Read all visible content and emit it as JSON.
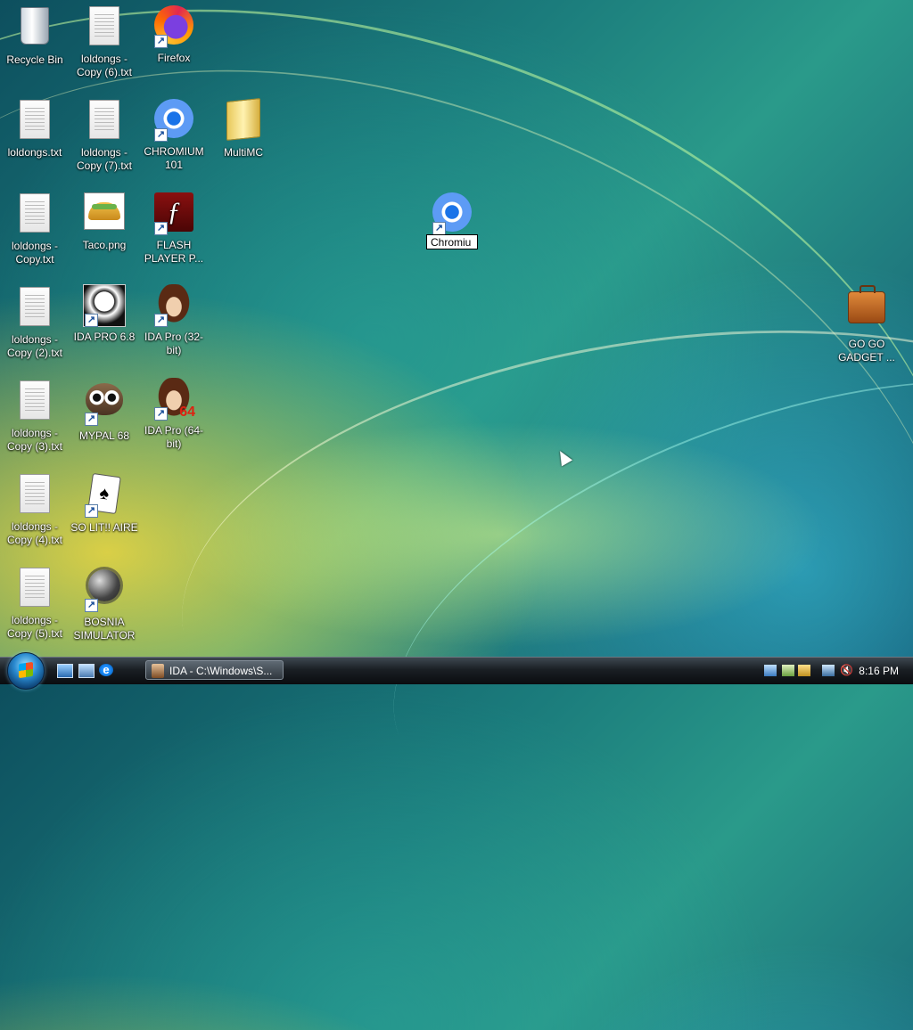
{
  "desktop_icons": [
    {
      "label": "Recycle Bin",
      "icon": "recycle-bin-icon"
    },
    {
      "label": "loldongs - Copy (6).txt",
      "icon": "text-file-icon"
    },
    {
      "label": "Firefox",
      "icon": "firefox-icon"
    },
    {
      "label": "loldongs.txt",
      "icon": "text-file-icon"
    },
    {
      "label": "loldongs - Copy (7).txt",
      "icon": "text-file-icon"
    },
    {
      "label": "CHROMIUM 101",
      "icon": "chromium-icon"
    },
    {
      "label": "MultiMC",
      "icon": "folder-icon"
    },
    {
      "label": "loldongs - Copy.txt",
      "icon": "text-file-icon"
    },
    {
      "label": "Taco.png",
      "icon": "image-file-icon"
    },
    {
      "label": "FLASH PLAYER P...",
      "icon": "flash-icon"
    },
    {
      "label": "loldongs - Copy (2).txt",
      "icon": "text-file-icon"
    },
    {
      "label": "IDA PRO 6.8",
      "icon": "ida-icon"
    },
    {
      "label": "IDA Pro (32-bit)",
      "icon": "ida-icon"
    },
    {
      "label": "loldongs - Copy (3).txt",
      "icon": "text-file-icon"
    },
    {
      "label": "MYPAL 68",
      "icon": "mypal-icon"
    },
    {
      "label": "IDA Pro (64-bit)",
      "icon": "ida-icon"
    },
    {
      "label": "loldongs - Copy (4).txt",
      "icon": "text-file-icon"
    },
    {
      "label": "SO LIT!! AIRE",
      "icon": "solitaire-icon"
    },
    {
      "label": "loldongs - Copy (5).txt",
      "icon": "text-file-icon"
    },
    {
      "label": "BOSNIA SIMULATOR",
      "icon": "minesweeper-icon"
    },
    {
      "label": "GO GO GADGET ...",
      "icon": "briefcase-icon"
    }
  ],
  "renaming_icon": {
    "value": "Chromiu",
    "icon": "chromium-icon"
  },
  "taskbar": {
    "task_label": "IDA - C:\\Windows\\S...",
    "clock": "8:16 PM"
  },
  "icon_badges": {
    "ida_64": "64"
  }
}
